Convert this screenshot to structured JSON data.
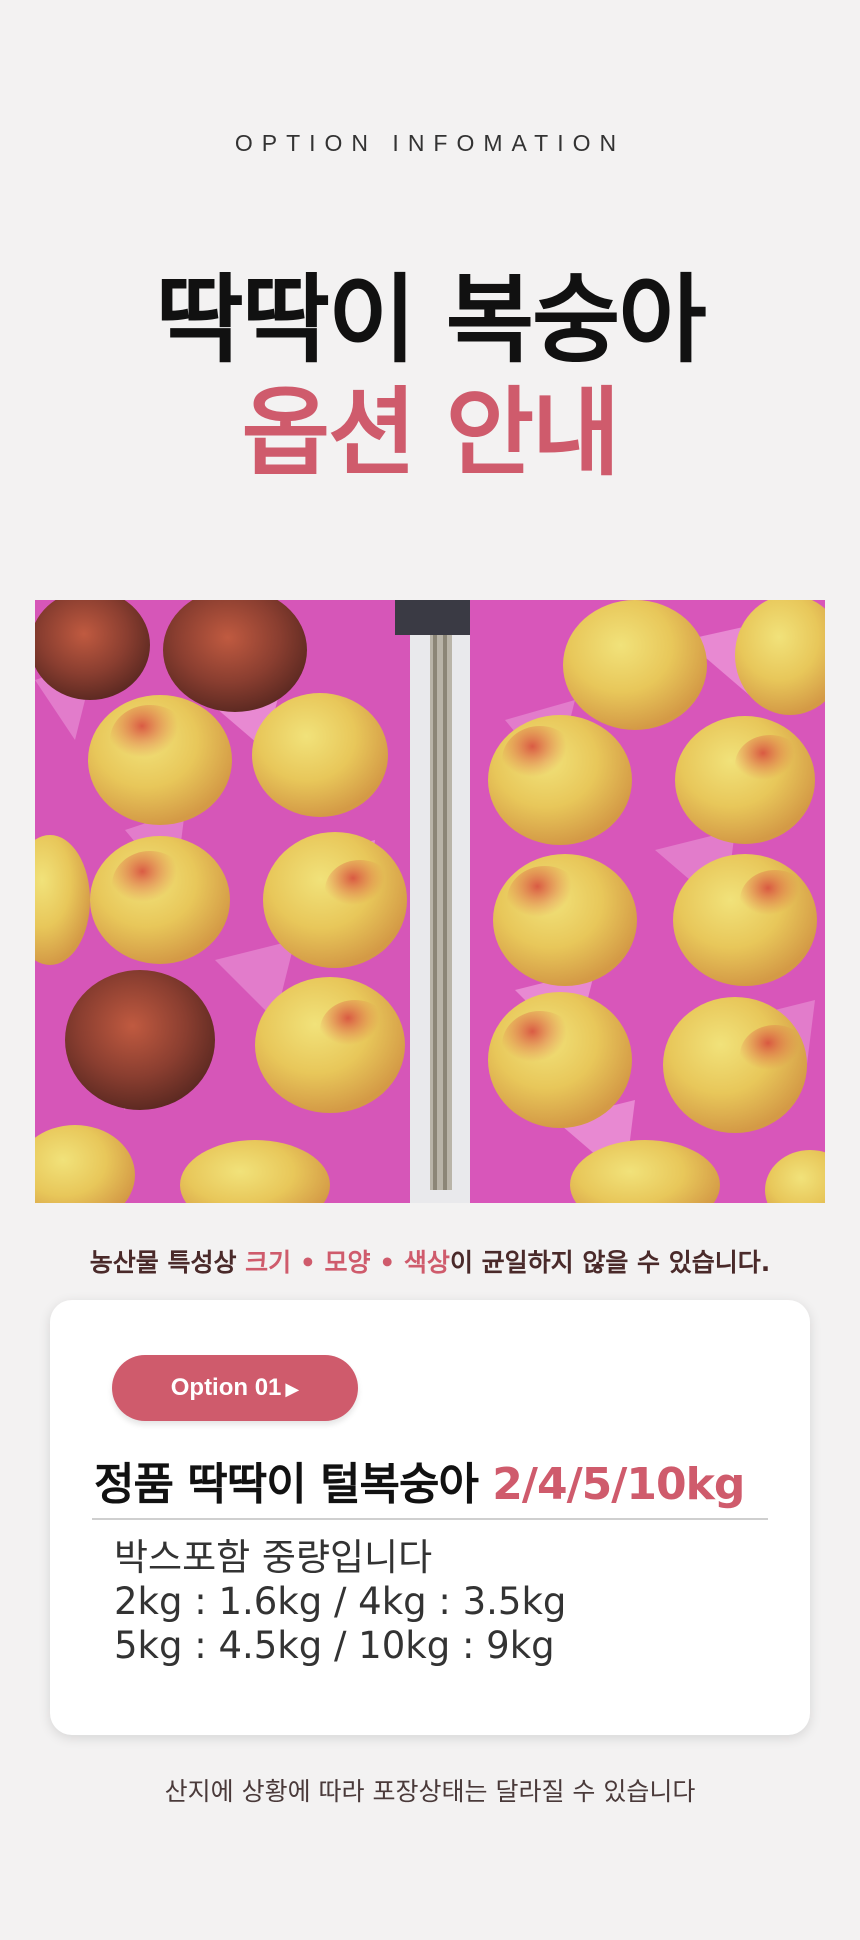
{
  "header": {
    "eyebrow": "OPTION INFOMATION",
    "title_line1": "딱딱이 복숭아",
    "title_line2": "옵션 안내"
  },
  "photo": {
    "description_icon": "peach-box-photo"
  },
  "notice": {
    "prefix": "농산물 특성상 ",
    "highlight": "크기 • 모양 • 색상",
    "suffix": "이 균일하지 않을 수 있습니다."
  },
  "option_card": {
    "badge_label": "Option 01",
    "badge_icon": "play-triangle-icon",
    "product_name": "정품 딱딱이 털복숭아",
    "product_weights": "2/4/5/10kg",
    "desc_line1": "박스포함 중량입니다",
    "desc_line2": "2kg : 1.6kg / 4kg : 3.5kg",
    "desc_line3": "5kg : 4.5kg / 10kg : 9kg"
  },
  "footer": {
    "text": "산지에 상황에 따라 포장상태는 달라질 수 있습니다"
  },
  "colors": {
    "accent": "#cf5b6c",
    "background": "#f3f2f2",
    "title": "#111111"
  }
}
